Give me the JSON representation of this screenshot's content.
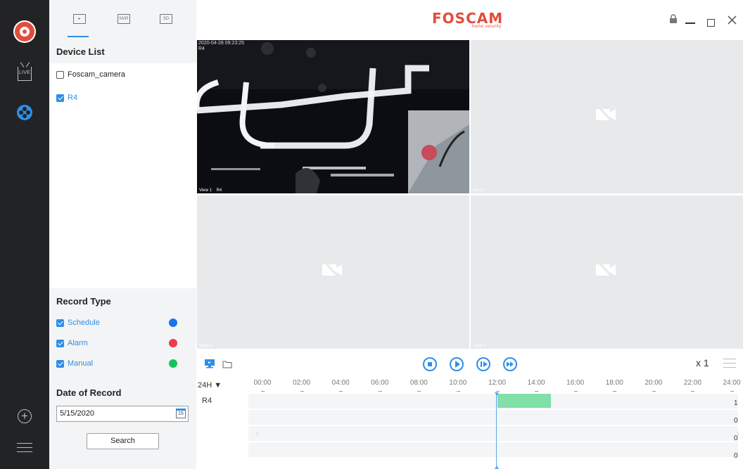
{
  "app": {
    "brand": "FOSCAM",
    "brand_sub": "home security"
  },
  "nav": {
    "live_label": "LIVE"
  },
  "panel": {
    "tabs": [
      {
        "name": "local",
        "label": ""
      },
      {
        "name": "nvr",
        "label": "NVR"
      },
      {
        "name": "sd",
        "label": "SD"
      }
    ],
    "device_list_title": "Device List",
    "devices": [
      {
        "label": "Foscam_camera",
        "checked": false
      },
      {
        "label": "R4",
        "checked": true
      }
    ],
    "record_type_title": "Record Type",
    "record_types": [
      {
        "label": "Schedule",
        "checked": true,
        "color": "#1a73e8"
      },
      {
        "label": "Alarm",
        "checked": true,
        "color": "#f0384f"
      },
      {
        "label": "Manual",
        "checked": true,
        "color": "#17c25a"
      }
    ],
    "date_title": "Date of Record",
    "date_value": "5/15/2020",
    "calendar_day": "15",
    "search_label": "Search"
  },
  "views": [
    {
      "label": "View 1",
      "channel": "R4",
      "timestamp": "2020-04-28 09:23:25",
      "overlay": "R4",
      "active": true
    },
    {
      "label": "View 2",
      "active": false
    },
    {
      "label": "View 3",
      "active": false
    },
    {
      "label": "View 4",
      "active": false
    }
  ],
  "playback": {
    "speed": "x 1"
  },
  "timeline": {
    "zoom": "24H",
    "hours": [
      "00:00",
      "02:00",
      "04:00",
      "06:00",
      "08:00",
      "10:00",
      "12:00",
      "14:00",
      "16:00",
      "18:00",
      "20:00",
      "22:00",
      "24:00"
    ],
    "rows": [
      {
        "name": "R4",
        "count": "1"
      },
      {
        "name": "",
        "count": "0"
      },
      {
        "name": "",
        "count": "0"
      },
      {
        "name": "",
        "count": "0"
      }
    ],
    "cursor_time": "12:00",
    "recording": {
      "start": "12:00",
      "end": "14:45"
    }
  },
  "colors": {
    "accent": "#2e8fe8",
    "brand": "#e14d3b",
    "recording": "#80e0a7"
  }
}
